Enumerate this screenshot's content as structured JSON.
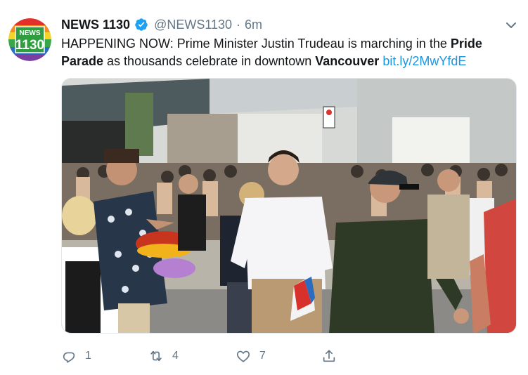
{
  "account": {
    "display_name": "NEWS 1130",
    "handle": "@NEWS1130",
    "separator": "·",
    "time_ago": "6m",
    "verified": true,
    "avatar_text_top": "NEWS",
    "avatar_text_bottom": "1130"
  },
  "tweet": {
    "text_part1": "HAPPENING NOW: Prime Minister Justin Trudeau is marching in the ",
    "bold1": "Pride Parade",
    "text_part2": " as thousands celebrate in downtown ",
    "bold2": "Vancouver",
    "text_part3": " ",
    "link": "bit.ly/2MwYfdE"
  },
  "stats": {
    "replies": "1",
    "retweets": "4",
    "likes": "7"
  },
  "icons": {
    "reply": "reply-icon",
    "retweet": "retweet-icon",
    "like": "heart-icon",
    "share": "share-icon",
    "more": "chevron-down-icon",
    "verified": "verified-badge-icon"
  },
  "colors": {
    "link": "#1b95e0",
    "muted": "#657786",
    "verified": "#1da1f2",
    "avatar_green": "#2e9e3f"
  }
}
